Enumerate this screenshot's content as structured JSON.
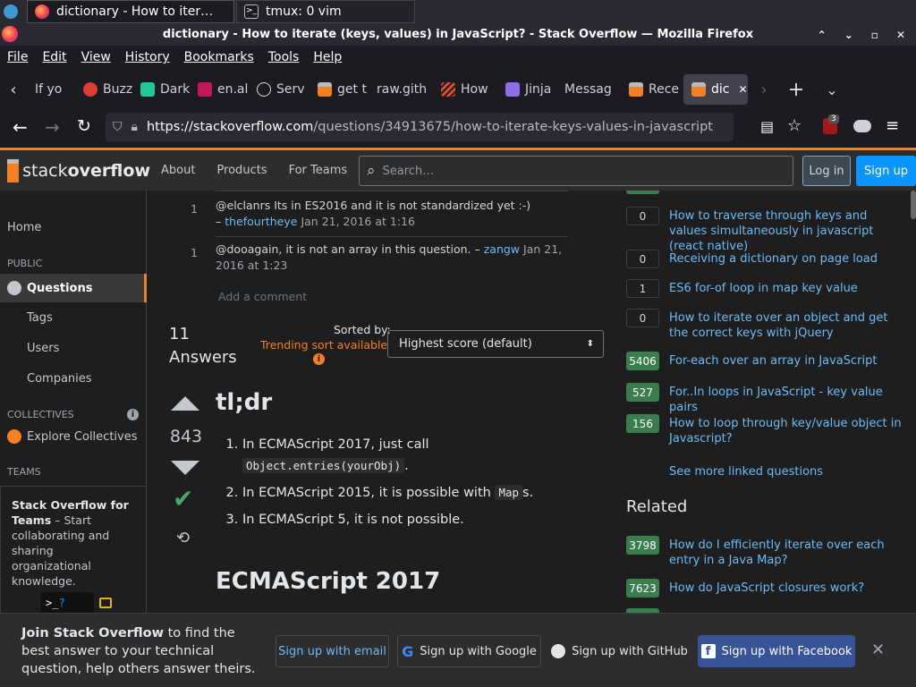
{
  "os_tabs": [
    {
      "title": "dictionary - How to iter…"
    },
    {
      "title": "tmux: 0 vim"
    }
  ],
  "window": {
    "title": "dictionary - How to iterate (keys, values) in JavaScript? - Stack Overflow — Mozilla Firefox"
  },
  "menubar": {
    "items": [
      "File",
      "Edit",
      "View",
      "History",
      "Bookmarks",
      "Tools",
      "Help"
    ]
  },
  "tabs": [
    {
      "label": "If yo",
      "icon": "info-icon"
    },
    {
      "label": "Buzz",
      "icon": "buzz-icon"
    },
    {
      "label": "Dark",
      "icon": "dark-icon"
    },
    {
      "label": "en.al",
      "icon": "en-icon"
    },
    {
      "label": "Serv",
      "icon": "info-icon"
    },
    {
      "label": "get t",
      "icon": "stackoverflow-icon"
    },
    {
      "label": "raw.gith",
      "icon": ""
    },
    {
      "label": "How",
      "icon": "how-icon"
    },
    {
      "label": "Jinja",
      "icon": "jinja-icon"
    },
    {
      "label": "Messag",
      "icon": ""
    },
    {
      "label": "Rece",
      "icon": "stackoverflow-icon"
    },
    {
      "label": "dic",
      "icon": "stackoverflow-icon"
    }
  ],
  "navbar": {
    "url_host": "https://stackoverflow.com",
    "url_path": "/questions/34913675/how-to-iterate-keys-values-in-javascript",
    "ublock_count": "3"
  },
  "so_header": {
    "logo_a": "stack",
    "logo_b": "overflow",
    "nav": [
      "About",
      "Products",
      "For Teams"
    ],
    "search_placeholder": "Search…",
    "login": "Log in",
    "signup": "Sign up"
  },
  "leftnav": {
    "home": "Home",
    "public": "PUBLIC",
    "questions": "Questions",
    "tags": "Tags",
    "users": "Users",
    "companies": "Companies",
    "collectives": "COLLECTIVES",
    "explore": "Explore Collectives",
    "teams": "TEAMS",
    "teams_title": "Stack Overflow for Teams",
    "teams_text": " – Start collaborating and sharing organizational knowledge."
  },
  "comments": [
    {
      "score": "1",
      "text": "@elclanrs Its in ES2016 and it is not standardized yet :-)",
      "author": "thefourtheye",
      "date": "Jan 21, 2016 at 1:16"
    },
    {
      "score": "1",
      "text": "@dooagain, it is not an array in this question.",
      "author": "zangw",
      "date": "Jan 21, 2016 at 1:23"
    }
  ],
  "add_comment": "Add a comment",
  "answers": {
    "count": "11",
    "label": "Answers",
    "sorted_by": "Sorted by:",
    "trending": "Trending sort available",
    "sort_value": "Highest score (default)"
  },
  "answer": {
    "score": "843",
    "heading": "tl;dr",
    "items": [
      {
        "pre": "In ECMAScript 2017, just call ",
        "code": "Object.entries(yourObj)",
        "post": "."
      },
      {
        "pre": "In ECMAScript 2015, it is possible with ",
        "code": "Map",
        "post": "s."
      },
      {
        "pre": "In ECMAScript 5, it is not possible.",
        "code": "",
        "post": ""
      }
    ],
    "heading2": "ECMAScript 2017"
  },
  "linked": [
    {
      "score": "0",
      "title": "How to traverse through keys and values simultaneously in javascript (react native)",
      "green": false
    },
    {
      "score": "0",
      "title": "Receiving a dictionary on page load",
      "green": false
    },
    {
      "score": "1",
      "title": "ES6 for-of loop in map key value",
      "green": false
    },
    {
      "score": "0",
      "title": "How to iterate over an object and get the correct keys with jQuery",
      "green": false
    },
    {
      "score": "5406",
      "title": "For-each over an array in JavaScript",
      "green": true
    },
    {
      "score": "527",
      "title": "For..In loops in JavaScript - key value pairs",
      "green": true
    },
    {
      "score": "156",
      "title": "How to loop through key/value object in Javascript?",
      "green": true
    }
  ],
  "see_more": "See more linked questions",
  "related_heading": "Related",
  "related": [
    {
      "score": "3798",
      "title": "How do I efficiently iterate over each entry in a Java Map?"
    },
    {
      "score": "7623",
      "title": "How do JavaScript closures work?"
    }
  ],
  "banner": {
    "bold": "Join Stack Overflow",
    "text": " to find the best answer to your technical question, help others answer theirs.",
    "email": "Sign up with email",
    "google": "Sign up with Google",
    "github": "Sign up with GitHub",
    "facebook": "Sign up with Facebook"
  },
  "colors": {
    "accent": "#f48024",
    "link": "#6cbbf7",
    "primary_button": "#0a95ff",
    "accepted": "#48a868",
    "facebook": "#385499"
  }
}
